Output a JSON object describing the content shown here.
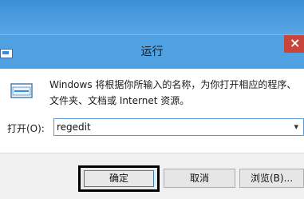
{
  "dialog": {
    "title": "运行",
    "description": "Windows 将根据你所输入的名称，为你打开相应的程序、文件夹、文档或 Internet 资源。",
    "open_label": "打开(O):",
    "open_value": "regedit",
    "buttons": {
      "ok": "确定",
      "cancel": "取消",
      "browse": "浏览(B)..."
    }
  },
  "icons": {
    "app": "run-app-icon",
    "run": "run-program-icon",
    "close": "close-icon",
    "dropdown": "chevron-down-icon"
  },
  "colors": {
    "titlebar": "#4fa1e2",
    "close": "#c7453a",
    "highlight": "#000000"
  }
}
